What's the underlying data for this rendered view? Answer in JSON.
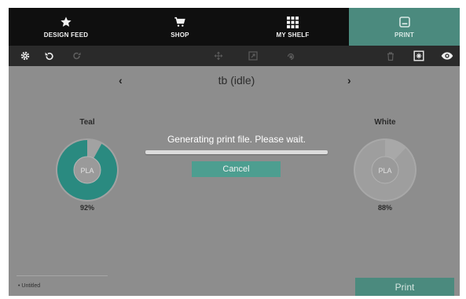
{
  "nav": {
    "tabs": [
      {
        "label": "DESIGN FEED",
        "icon": "star-icon"
      },
      {
        "label": "SHOP",
        "icon": "cart-icon"
      },
      {
        "label": "MY SHELF",
        "icon": "grid-icon"
      },
      {
        "label": "PRINT",
        "icon": "printer-icon",
        "active": true
      }
    ]
  },
  "toolbar": {
    "left": [
      "settings-icon",
      "undo-icon",
      "redo-icon"
    ],
    "center": [
      "move-icon",
      "scale-icon",
      "rotate-icon"
    ],
    "right": [
      "delete-icon",
      "fit-icon",
      "eye-icon"
    ]
  },
  "printer": {
    "title": "tb (idle)",
    "prev_arrow": "‹",
    "next_arrow": "›"
  },
  "spools": [
    {
      "name": "Teal",
      "material": "PLA",
      "percent_label": "92%",
      "level": 0.92,
      "color": "#2a8a80"
    },
    {
      "name": "White",
      "material": "PLA",
      "percent_label": "88%",
      "level": 0.88,
      "color": "#ececec"
    }
  ],
  "dialog": {
    "message": "Generating print file. Please wait.",
    "cancel_label": "Cancel"
  },
  "file": {
    "name": "Untitled"
  },
  "print_button": {
    "label": "Print"
  },
  "colors": {
    "accent": "#4b8a7e",
    "overlay": "#8d8d8d",
    "nav_bg": "#0f0f0f"
  }
}
